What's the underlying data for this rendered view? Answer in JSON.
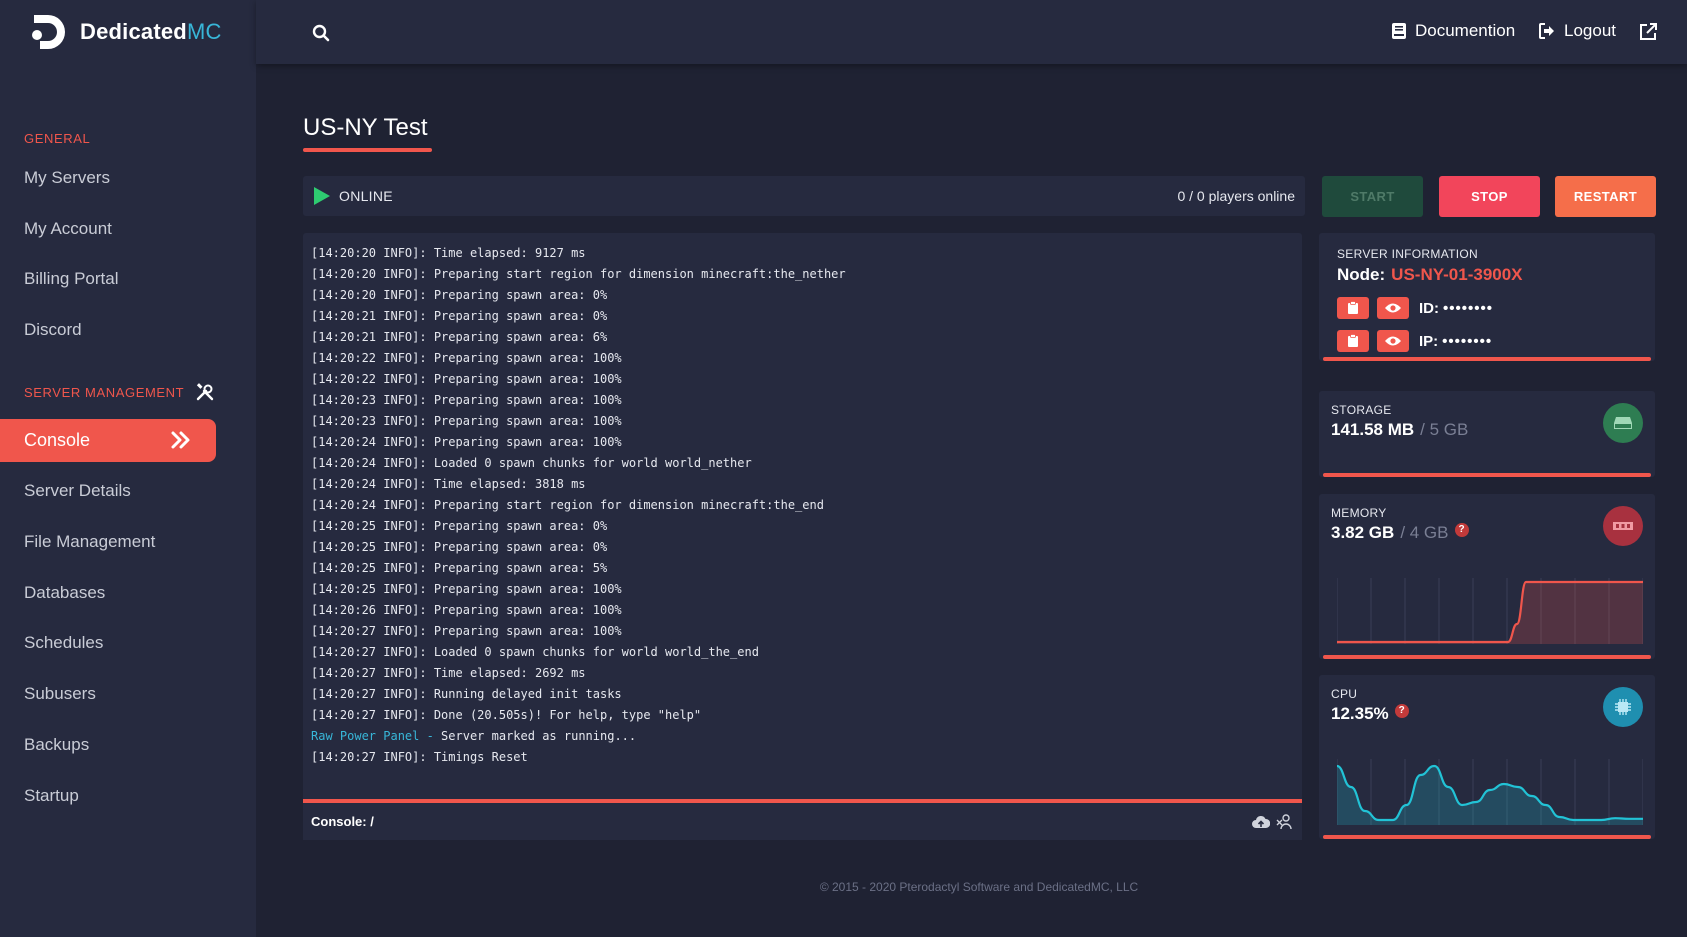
{
  "brand": {
    "name_main": "Dedicated",
    "name_accent": "MC"
  },
  "topbar": {
    "documentation_label": "Documention",
    "logout_label": "Logout"
  },
  "sidebar": {
    "general_label": "GENERAL",
    "general_items": [
      {
        "label": "My Servers"
      },
      {
        "label": "My Account"
      },
      {
        "label": "Billing Portal"
      },
      {
        "label": "Discord"
      }
    ],
    "server_mgmt_label": "SERVER MANAGEMENT",
    "server_items": [
      {
        "label": "Console",
        "active": true
      },
      {
        "label": "Server Details"
      },
      {
        "label": "File Management"
      },
      {
        "label": "Databases"
      },
      {
        "label": "Schedules"
      },
      {
        "label": "Subusers"
      },
      {
        "label": "Backups"
      },
      {
        "label": "Startup"
      }
    ]
  },
  "page": {
    "title": "US-NY Test"
  },
  "status": {
    "state": "ONLINE",
    "players": "0 / 0 players online",
    "state_color": "#2ecc71"
  },
  "controls": {
    "start": "START",
    "stop": "STOP",
    "restart": "RESTART"
  },
  "console": {
    "lines": [
      "[14:20:20 INFO]: Time elapsed: 9127 ms",
      "[14:20:20 INFO]: Preparing start region for dimension minecraft:the_nether",
      "[14:20:20 INFO]: Preparing spawn area: 0%",
      "[14:20:21 INFO]: Preparing spawn area: 0%",
      "[14:20:21 INFO]: Preparing spawn area: 6%",
      "[14:20:22 INFO]: Preparing spawn area: 100%",
      "[14:20:22 INFO]: Preparing spawn area: 100%",
      "[14:20:23 INFO]: Preparing spawn area: 100%",
      "[14:20:23 INFO]: Preparing spawn area: 100%",
      "[14:20:24 INFO]: Preparing spawn area: 100%",
      "[14:20:24 INFO]: Loaded 0 spawn chunks for world world_nether",
      "[14:20:24 INFO]: Time elapsed: 3818 ms",
      "[14:20:24 INFO]: Preparing start region for dimension minecraft:the_end",
      "[14:20:25 INFO]: Preparing spawn area: 0%",
      "[14:20:25 INFO]: Preparing spawn area: 0%",
      "[14:20:25 INFO]: Preparing spawn area: 5%",
      "[14:20:25 INFO]: Preparing spawn area: 100%",
      "[14:20:26 INFO]: Preparing spawn area: 100%",
      "[14:20:27 INFO]: Preparing spawn area: 100%",
      "[14:20:27 INFO]: Loaded 0 spawn chunks for world world_the_end",
      "[14:20:27 INFO]: Time elapsed: 2692 ms",
      "[14:20:27 INFO]: Running delayed init tasks",
      "[14:20:27 INFO]: Done (20.505s)! For help, type \"help\""
    ],
    "panel_prefix": "Raw Power Panel -",
    "panel_message": " Server marked as running...",
    "last_line": "[14:20:27 INFO]: Timings Reset",
    "prompt": "Console: /",
    "input_value": ""
  },
  "server_info": {
    "label": "SERVER INFORMATION",
    "node_key": "Node:",
    "node_value": "US-NY-01-3900X",
    "id_key": "ID:",
    "id_value": "••••••••",
    "ip_key": "IP:",
    "ip_value": "••••••••"
  },
  "storage": {
    "label": "STORAGE",
    "used": "141.58 MB",
    "total": "/ 5 GB",
    "icon": "hdd-icon",
    "icon_color": "#2e7d52"
  },
  "memory": {
    "label": "MEMORY",
    "used": "3.82 GB",
    "total": "/ 4 GB",
    "help": "?",
    "icon": "memory-icon",
    "icon_color": "#a8313f",
    "series": [
      0,
      0,
      0,
      0,
      0,
      0,
      0,
      0,
      0,
      0,
      0,
      0,
      0,
      0,
      0,
      0,
      0,
      0,
      0,
      0,
      0.3,
      1,
      1,
      1,
      1,
      1,
      1,
      1,
      1,
      1,
      1,
      1,
      1,
      1,
      1
    ]
  },
  "cpu": {
    "label": "CPU",
    "value": "12.35%",
    "help": "?",
    "icon": "cpu-icon",
    "icon_color": "#1f8fb0",
    "series": [
      0.95,
      0.6,
      0.2,
      0.05,
      0.05,
      0.3,
      0.8,
      0.95,
      0.6,
      0.3,
      0.35,
      0.55,
      0.65,
      0.6,
      0.45,
      0.3,
      0.1,
      0.05,
      0.05,
      0.05,
      0.08,
      0.07,
      0.07
    ]
  },
  "footer": {
    "text": "© 2015 - 2020 Pterodactyl Software and DedicatedMC, LLC"
  }
}
